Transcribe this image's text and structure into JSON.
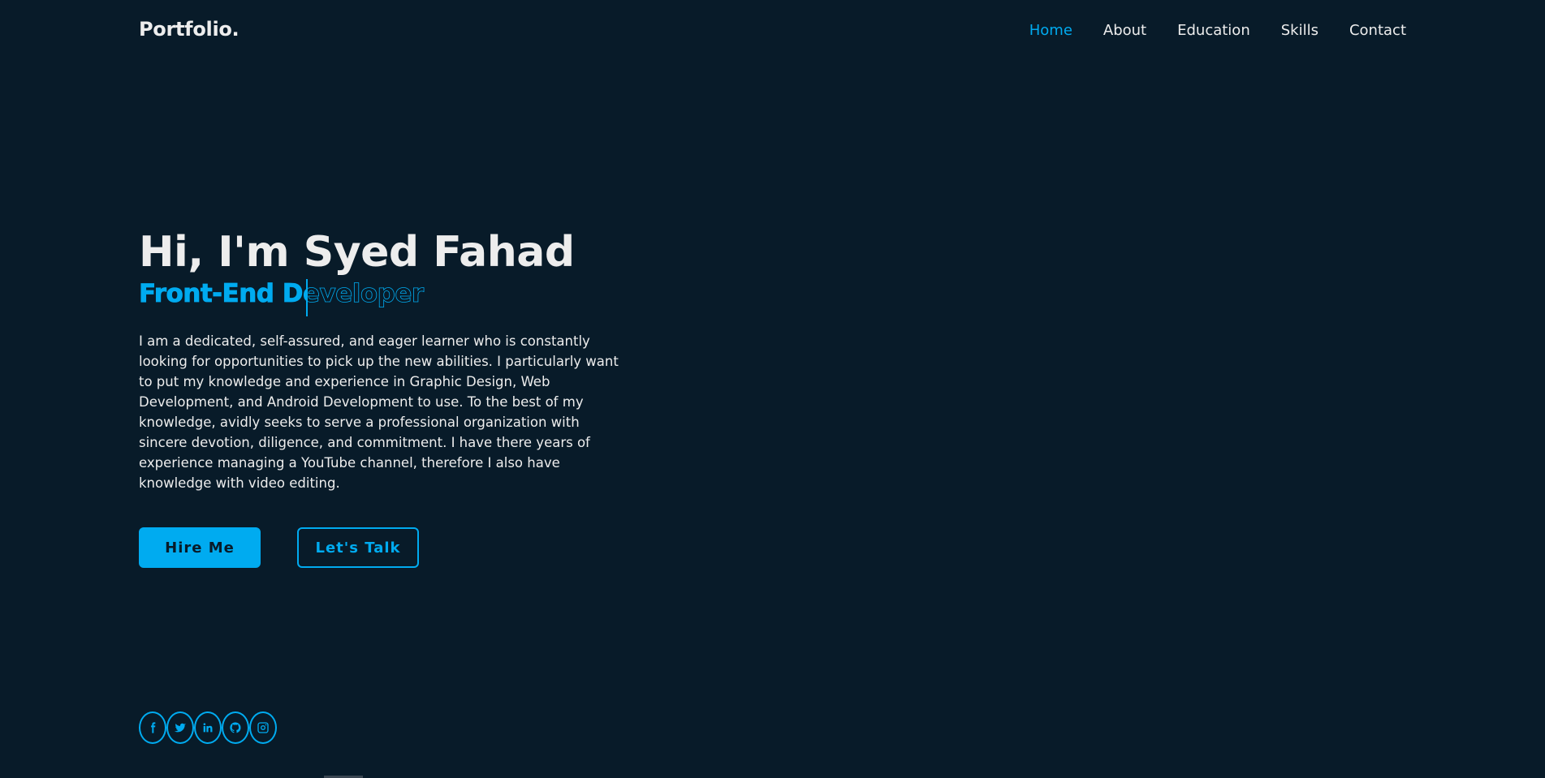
{
  "header": {
    "logo": "Portfolio.",
    "nav": [
      {
        "label": "Home",
        "active": true
      },
      {
        "label": "About",
        "active": false
      },
      {
        "label": "Education",
        "active": false
      },
      {
        "label": "Skills",
        "active": false
      },
      {
        "label": "Contact",
        "active": false
      }
    ]
  },
  "home": {
    "title": "Hi, I'm Syed Fahad",
    "subtitle": "Front-End Developer",
    "description": "I am a dedicated, self-assured, and eager learner who is constantly looking for opportunities to pick up the new abilities. I particularly want to put my knowledge and experience in Graphic Design, Web Development, and Android Development to use. To the best of my knowledge, avidly seeks to serve a professional organization with sincere devotion, diligence, and commitment. I have there years of experience managing a YouTube channel, therefore I also have knowledge with video editing.",
    "buttons": {
      "hire": "Hire Me",
      "talk": "Let's Talk"
    }
  },
  "social": [
    "facebook-icon",
    "twitter-icon",
    "linkedin-icon",
    "github-icon",
    "instagram-icon"
  ],
  "colors": {
    "background": "#081b29",
    "accent": "#00abf0",
    "text": "#ededed"
  }
}
